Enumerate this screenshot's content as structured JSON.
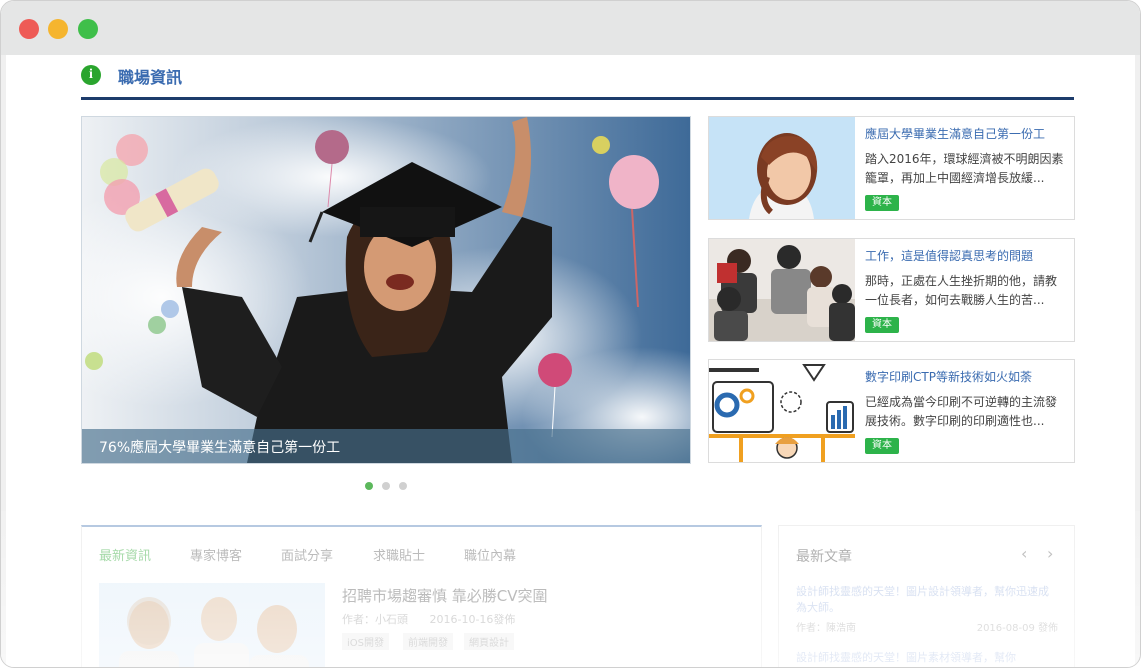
{
  "window": {
    "controls": [
      "close",
      "minimize",
      "maximize"
    ]
  },
  "section": {
    "icon": "info-icon",
    "title": "職場資訊"
  },
  "hero": {
    "caption": "76%應屆大學畢業生滿意自己第一份工",
    "slide_count": 3,
    "active_slide": 1
  },
  "side_articles": [
    {
      "title": "應屆大學畢業生滿意自己第一份工",
      "excerpt": "踏入2016年，環球經濟被不明朗因素籠罩，再加上中國經濟增長放緩...",
      "tag": "資本"
    },
    {
      "title": "工作，這是值得認真思考的問題",
      "excerpt": "那時，正處在人生挫折期的他，請教一位長者，如何去戰勝人生的苦...",
      "tag": "資本"
    },
    {
      "title": "數字印刷CTP等新技術如火如荼",
      "excerpt": "已經成為當今印刷不可逆轉的主流發展技術。數字印刷的印刷適性也...",
      "tag": "資本"
    }
  ],
  "tabs": [
    "最新資訊",
    "專家博客",
    "面試分享",
    "求職貼士",
    "職位內幕"
  ],
  "active_tab": 0,
  "featured": {
    "title": "招聘市場趨審慎 靠必勝CV突圍",
    "author": "作者：小石頭",
    "date": "2016-10-16發佈",
    "tags": [
      "iOS開發",
      "前端開發",
      "網頁設計"
    ]
  },
  "latest": {
    "title": "最新文章",
    "items": [
      {
        "title": "設計師找靈感的天堂！圖片設計領導者，幫你迅速成為大師。",
        "author": "作者：陳浩南",
        "date": "2016-08-09 發佈"
      },
      {
        "title": "設計師找靈感的天堂！圖片素材領導者，幫你",
        "author": "",
        "date": ""
      }
    ]
  },
  "colors": {
    "accent_blue": "#1d3c6b",
    "link_blue": "#3a6bb0",
    "tag_green": "#2db34a",
    "active_dot": "#5cb85c"
  }
}
